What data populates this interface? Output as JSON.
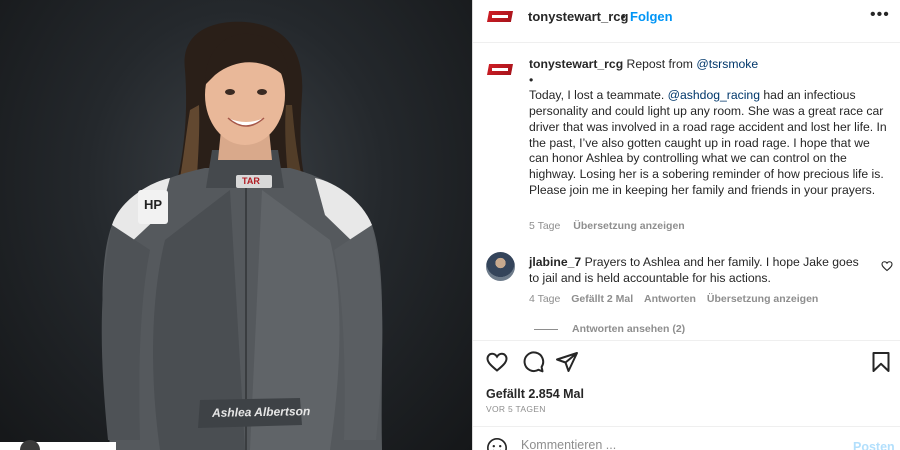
{
  "post": {
    "username": "tonystewart_rcg",
    "separator": "•",
    "follow_label": "Folgen",
    "more_icon": "more-horizontal-icon",
    "photo_name_text": "Ashlea Albertson",
    "photo_suit_badge": "HP",
    "photo_logo": "TAR",
    "caption": {
      "username": "tonystewart_rcg",
      "repost_prefix": "Repost from",
      "repost_handle": "@tsrsmoke",
      "bullet": "•",
      "text_1": "Today, I lost a teammate.",
      "mention": "@ashdog_racing",
      "text_2": "had an infectious personality and could light up any room. She was a great race car driver that was involved in a road rage accident and lost her life. In the past, I’ve also gotten caught up in road rage. I hope that we can honor Ashlea by controlling what we can control on the highway. Losing her is a sobering reminder of how precious life is. Please join me in keeping her family and friends in your prayers.",
      "age": "5 Tage",
      "translate_label": "Übersetzung anzeigen"
    },
    "comments": [
      {
        "username": "jlabine_7",
        "text": "Prayers to Ashlea and her family. I hope Jake goes to jail and is held accountable for his actions.",
        "age": "4 Tage",
        "likes": "Gefällt 2 Mal",
        "reply_label": "Antworten",
        "translate_label": "Übersetzung anzeigen",
        "view_replies_label": "Antworten ansehen (2)"
      }
    ],
    "likes_label": "Gefällt 2.854 Mal",
    "date_label": "VOR 5 TAGEN",
    "comment_placeholder": "Kommentieren ...",
    "post_button_label": "Posten",
    "colors": {
      "link_blue": "#0095f6",
      "mention": "#00376b",
      "muted": "#8e8e8e",
      "post_disabled": "#b2dffc",
      "logo_red": "#d11f26"
    }
  }
}
